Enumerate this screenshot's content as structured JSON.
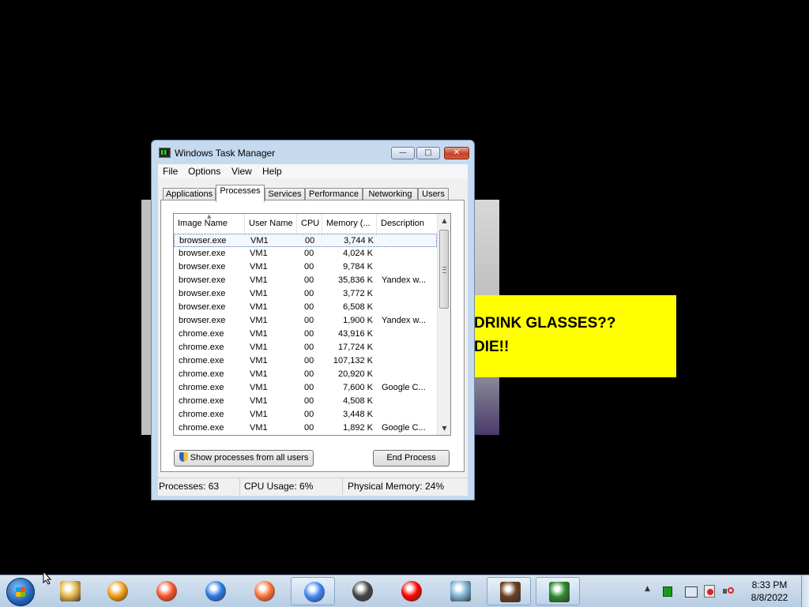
{
  "background_banner": {
    "line1": "DRINK GLASSES??",
    "line2": "DIE!!"
  },
  "window": {
    "title": "Windows Task Manager",
    "min_label": "—",
    "max_label": "□",
    "close_label": "✕"
  },
  "menu": [
    "File",
    "Options",
    "View",
    "Help"
  ],
  "tabs": [
    "Applications",
    "Processes",
    "Services",
    "Performance",
    "Networking",
    "Users"
  ],
  "active_tab": "Processes",
  "columns": [
    "Image Name",
    "User Name",
    "CPU",
    "Memory (...",
    "Description"
  ],
  "processes": [
    {
      "image": "browser.exe",
      "user": "VM1",
      "cpu": "00",
      "memory": "3,744 K",
      "description": ""
    },
    {
      "image": "browser.exe",
      "user": "VM1",
      "cpu": "00",
      "memory": "4,024 K",
      "description": ""
    },
    {
      "image": "browser.exe",
      "user": "VM1",
      "cpu": "00",
      "memory": "9,784 K",
      "description": ""
    },
    {
      "image": "browser.exe",
      "user": "VM1",
      "cpu": "00",
      "memory": "35,836 K",
      "description": "Yandex w..."
    },
    {
      "image": "browser.exe",
      "user": "VM1",
      "cpu": "00",
      "memory": "3,772 K",
      "description": ""
    },
    {
      "image": "browser.exe",
      "user": "VM1",
      "cpu": "00",
      "memory": "6,508 K",
      "description": ""
    },
    {
      "image": "browser.exe",
      "user": "VM1",
      "cpu": "00",
      "memory": "1,900 K",
      "description": "Yandex w..."
    },
    {
      "image": "chrome.exe",
      "user": "VM1",
      "cpu": "00",
      "memory": "43,916 K",
      "description": ""
    },
    {
      "image": "chrome.exe",
      "user": "VM1",
      "cpu": "00",
      "memory": "17,724 K",
      "description": ""
    },
    {
      "image": "chrome.exe",
      "user": "VM1",
      "cpu": "00",
      "memory": "107,132 K",
      "description": ""
    },
    {
      "image": "chrome.exe",
      "user": "VM1",
      "cpu": "00",
      "memory": "20,920 K",
      "description": ""
    },
    {
      "image": "chrome.exe",
      "user": "VM1",
      "cpu": "00",
      "memory": "7,600 K",
      "description": "Google C..."
    },
    {
      "image": "chrome.exe",
      "user": "VM1",
      "cpu": "00",
      "memory": "4,508 K",
      "description": ""
    },
    {
      "image": "chrome.exe",
      "user": "VM1",
      "cpu": "00",
      "memory": "3,448 K",
      "description": ""
    },
    {
      "image": "chrome.exe",
      "user": "VM1",
      "cpu": "00",
      "memory": "1,892 K",
      "description": "Google C..."
    }
  ],
  "buttons": {
    "show_all": "Show processes from all users",
    "end_process": "End Process"
  },
  "status": {
    "processes": "Processes: 63",
    "cpu": "CPU Usage: 6%",
    "memory": "Physical Memory: 24%"
  },
  "taskbar": {
    "apps": [
      {
        "name": "file-explorer-icon",
        "color": "#e8b84a"
      },
      {
        "name": "media-player-icon",
        "color": "#f39c12"
      },
      {
        "name": "brave-icon",
        "color": "#fb542b"
      },
      {
        "name": "wps-icon",
        "color": "#2a7be4"
      },
      {
        "name": "firefox-icon",
        "color": "#ff7139"
      },
      {
        "name": "chrome-icon",
        "color": "#4285f4"
      },
      {
        "name": "raccoon-icon",
        "color": "#444444"
      },
      {
        "name": "yandex-icon",
        "color": "#ff0000"
      },
      {
        "name": "notepad-icon",
        "color": "#7fb3d5"
      },
      {
        "name": "coffee-icon",
        "color": "#6b3e1f"
      },
      {
        "name": "task-manager-icon",
        "color": "#2e8b2e"
      }
    ],
    "clock_time": "8:33 PM",
    "clock_date": "8/8/2022"
  }
}
